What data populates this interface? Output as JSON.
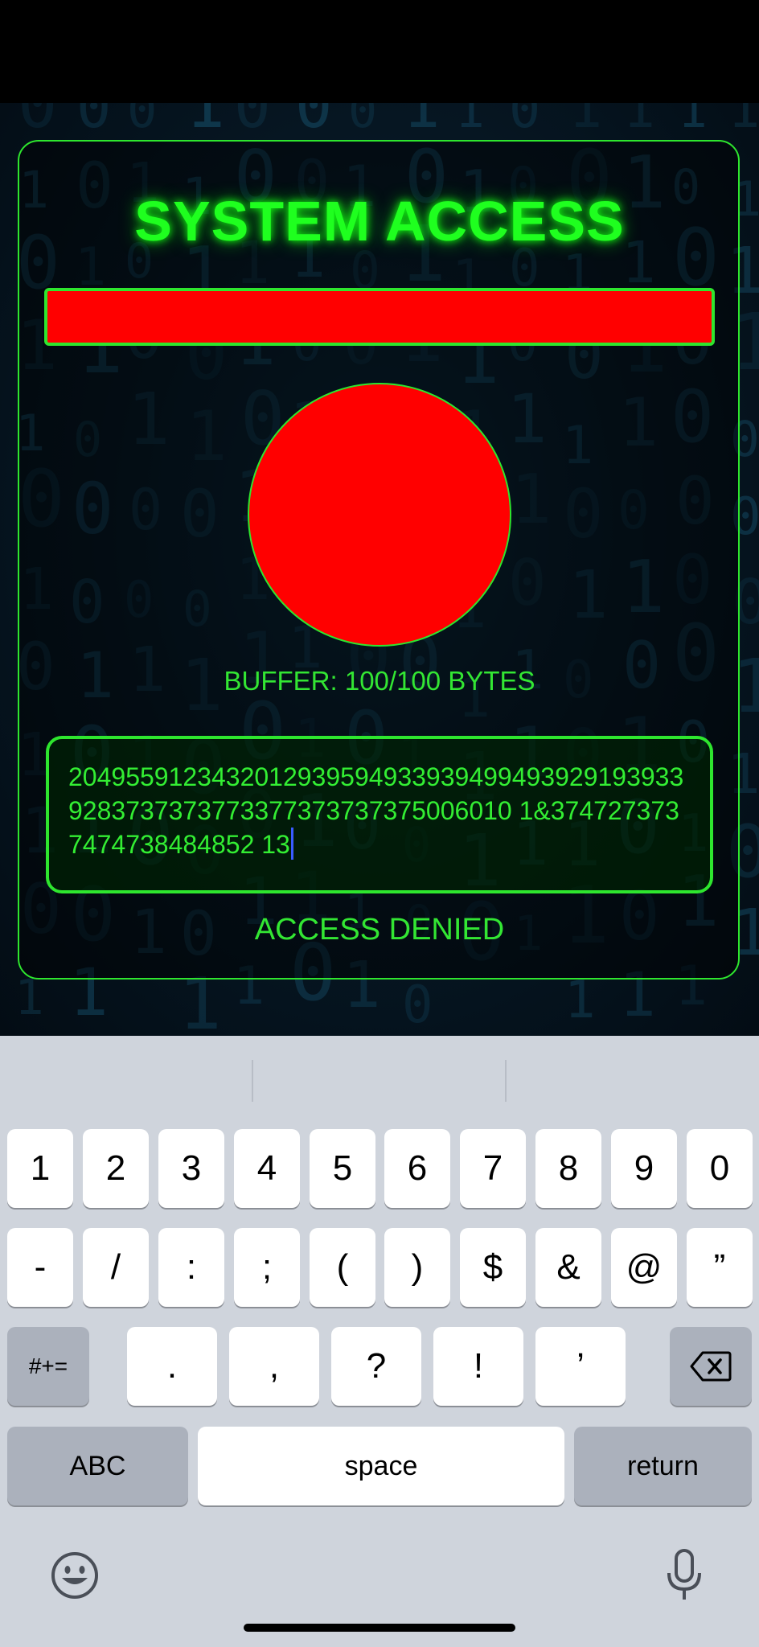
{
  "app": {
    "title": "SYSTEM ACCESS",
    "buffer_label": "BUFFER: 100/100 BYTES",
    "payload_value": "20495591234320129395949339394994939291939339283737373773377373737375006010 1&3747273737474738484852 13",
    "access_status": "ACCESS DENIED",
    "colors": {
      "accent_green": "#1fff1f",
      "alert_red": "#ff0000",
      "cursor_blue": "#3a5bff"
    }
  },
  "keyboard": {
    "row1": [
      "1",
      "2",
      "3",
      "4",
      "5",
      "6",
      "7",
      "8",
      "9",
      "0"
    ],
    "row2": [
      "-",
      "/",
      ":",
      ";",
      "(",
      ")",
      "$",
      "&",
      "@",
      "”"
    ],
    "row3_toggle": "#+=",
    "row3": [
      ".",
      ",",
      "?",
      "!",
      "’"
    ],
    "abc_label": "ABC",
    "space_label": "space",
    "return_label": "return",
    "delete_icon": "backspace-icon",
    "emoji_icon": "emoji-icon",
    "mic_icon": "microphone-icon"
  }
}
